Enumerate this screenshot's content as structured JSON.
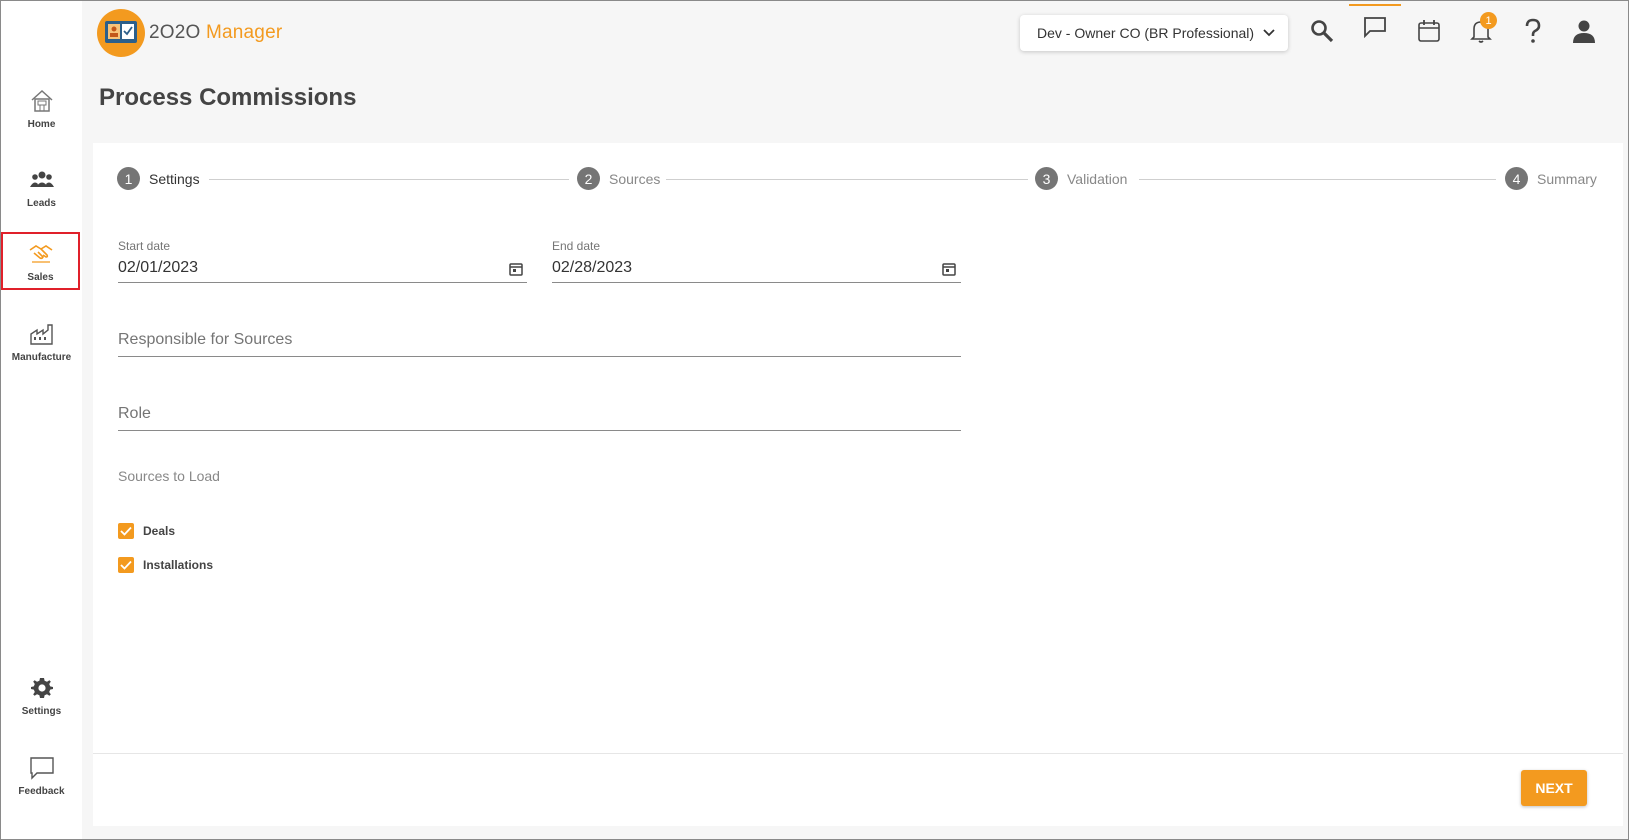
{
  "app": {
    "logo_num": "2O2O",
    "logo_text": "Manager",
    "org_selector": "Dev - Owner CO (BR Professional)",
    "notification_count": "1"
  },
  "sidebar": {
    "items": [
      {
        "label": "Home",
        "icon": "home-icon"
      },
      {
        "label": "Leads",
        "icon": "people-icon"
      },
      {
        "label": "Sales",
        "icon": "handshake-icon",
        "active": true
      },
      {
        "label": "Manufacture",
        "icon": "factory-icon"
      },
      {
        "label": "Settings",
        "icon": "gear-icon"
      },
      {
        "label": "Feedback",
        "icon": "chat-icon"
      }
    ]
  },
  "page": {
    "title": "Process Commissions"
  },
  "stepper": {
    "steps": [
      {
        "num": "1",
        "label": "Settings"
      },
      {
        "num": "2",
        "label": "Sources"
      },
      {
        "num": "3",
        "label": "Validation"
      },
      {
        "num": "4",
        "label": "Summary"
      }
    ]
  },
  "form": {
    "start_date": {
      "label": "Start date",
      "value": "02/01/2023"
    },
    "end_date": {
      "label": "End date",
      "value": "02/28/2023"
    },
    "responsible": {
      "placeholder": "Responsible for Sources"
    },
    "role": {
      "placeholder": "Role"
    },
    "sources_label": "Sources to Load",
    "sources": [
      {
        "label": "Deals",
        "checked": true
      },
      {
        "label": "Installations",
        "checked": true
      }
    ]
  },
  "footer": {
    "next_label": "NEXT"
  },
  "colors": {
    "accent": "#f39a1f",
    "active_border": "#e0202a"
  }
}
